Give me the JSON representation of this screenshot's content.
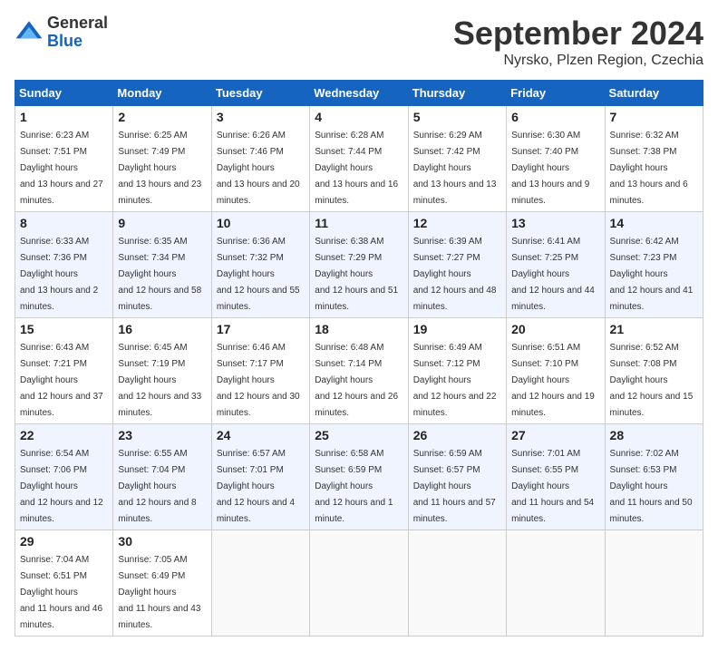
{
  "logo": {
    "general": "General",
    "blue": "Blue"
  },
  "title": "September 2024",
  "subtitle": "Nyrsko, Plzen Region, Czechia",
  "headers": [
    "Sunday",
    "Monday",
    "Tuesday",
    "Wednesday",
    "Thursday",
    "Friday",
    "Saturday"
  ],
  "weeks": [
    [
      {
        "day": "1",
        "sunrise": "6:23 AM",
        "sunset": "7:51 PM",
        "daylight": "13 hours and 27 minutes."
      },
      {
        "day": "2",
        "sunrise": "6:25 AM",
        "sunset": "7:49 PM",
        "daylight": "13 hours and 23 minutes."
      },
      {
        "day": "3",
        "sunrise": "6:26 AM",
        "sunset": "7:46 PM",
        "daylight": "13 hours and 20 minutes."
      },
      {
        "day": "4",
        "sunrise": "6:28 AM",
        "sunset": "7:44 PM",
        "daylight": "13 hours and 16 minutes."
      },
      {
        "day": "5",
        "sunrise": "6:29 AM",
        "sunset": "7:42 PM",
        "daylight": "13 hours and 13 minutes."
      },
      {
        "day": "6",
        "sunrise": "6:30 AM",
        "sunset": "7:40 PM",
        "daylight": "13 hours and 9 minutes."
      },
      {
        "day": "7",
        "sunrise": "6:32 AM",
        "sunset": "7:38 PM",
        "daylight": "13 hours and 6 minutes."
      }
    ],
    [
      {
        "day": "8",
        "sunrise": "6:33 AM",
        "sunset": "7:36 PM",
        "daylight": "13 hours and 2 minutes."
      },
      {
        "day": "9",
        "sunrise": "6:35 AM",
        "sunset": "7:34 PM",
        "daylight": "12 hours and 58 minutes."
      },
      {
        "day": "10",
        "sunrise": "6:36 AM",
        "sunset": "7:32 PM",
        "daylight": "12 hours and 55 minutes."
      },
      {
        "day": "11",
        "sunrise": "6:38 AM",
        "sunset": "7:29 PM",
        "daylight": "12 hours and 51 minutes."
      },
      {
        "day": "12",
        "sunrise": "6:39 AM",
        "sunset": "7:27 PM",
        "daylight": "12 hours and 48 minutes."
      },
      {
        "day": "13",
        "sunrise": "6:41 AM",
        "sunset": "7:25 PM",
        "daylight": "12 hours and 44 minutes."
      },
      {
        "day": "14",
        "sunrise": "6:42 AM",
        "sunset": "7:23 PM",
        "daylight": "12 hours and 41 minutes."
      }
    ],
    [
      {
        "day": "15",
        "sunrise": "6:43 AM",
        "sunset": "7:21 PM",
        "daylight": "12 hours and 37 minutes."
      },
      {
        "day": "16",
        "sunrise": "6:45 AM",
        "sunset": "7:19 PM",
        "daylight": "12 hours and 33 minutes."
      },
      {
        "day": "17",
        "sunrise": "6:46 AM",
        "sunset": "7:17 PM",
        "daylight": "12 hours and 30 minutes."
      },
      {
        "day": "18",
        "sunrise": "6:48 AM",
        "sunset": "7:14 PM",
        "daylight": "12 hours and 26 minutes."
      },
      {
        "day": "19",
        "sunrise": "6:49 AM",
        "sunset": "7:12 PM",
        "daylight": "12 hours and 22 minutes."
      },
      {
        "day": "20",
        "sunrise": "6:51 AM",
        "sunset": "7:10 PM",
        "daylight": "12 hours and 19 minutes."
      },
      {
        "day": "21",
        "sunrise": "6:52 AM",
        "sunset": "7:08 PM",
        "daylight": "12 hours and 15 minutes."
      }
    ],
    [
      {
        "day": "22",
        "sunrise": "6:54 AM",
        "sunset": "7:06 PM",
        "daylight": "12 hours and 12 minutes."
      },
      {
        "day": "23",
        "sunrise": "6:55 AM",
        "sunset": "7:04 PM",
        "daylight": "12 hours and 8 minutes."
      },
      {
        "day": "24",
        "sunrise": "6:57 AM",
        "sunset": "7:01 PM",
        "daylight": "12 hours and 4 minutes."
      },
      {
        "day": "25",
        "sunrise": "6:58 AM",
        "sunset": "6:59 PM",
        "daylight": "12 hours and 1 minute."
      },
      {
        "day": "26",
        "sunrise": "6:59 AM",
        "sunset": "6:57 PM",
        "daylight": "11 hours and 57 minutes."
      },
      {
        "day": "27",
        "sunrise": "7:01 AM",
        "sunset": "6:55 PM",
        "daylight": "11 hours and 54 minutes."
      },
      {
        "day": "28",
        "sunrise": "7:02 AM",
        "sunset": "6:53 PM",
        "daylight": "11 hours and 50 minutes."
      }
    ],
    [
      {
        "day": "29",
        "sunrise": "7:04 AM",
        "sunset": "6:51 PM",
        "daylight": "11 hours and 46 minutes."
      },
      {
        "day": "30",
        "sunrise": "7:05 AM",
        "sunset": "6:49 PM",
        "daylight": "11 hours and 43 minutes."
      },
      null,
      null,
      null,
      null,
      null
    ]
  ]
}
